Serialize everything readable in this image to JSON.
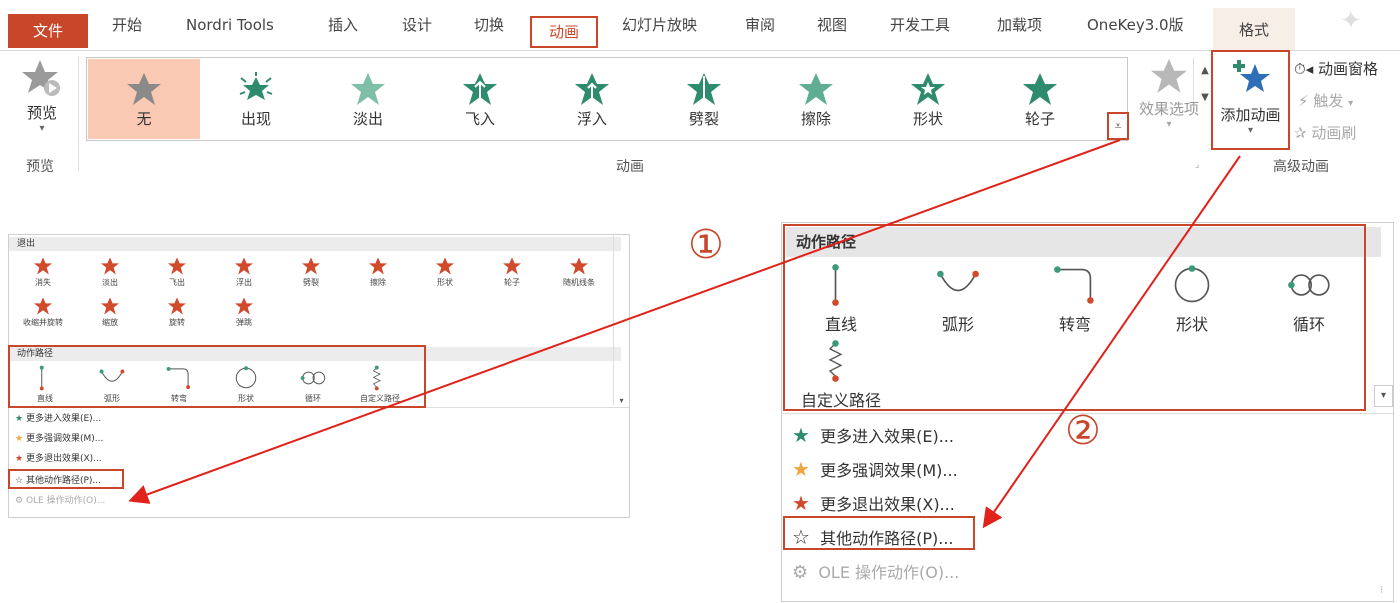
{
  "tabs": {
    "file": "文件",
    "home": "开始",
    "nordri": "Nordri Tools",
    "insert": "插入",
    "design": "设计",
    "transitions": "切换",
    "animations": "动画",
    "slideshow": "幻灯片放映",
    "review": "审阅",
    "view": "视图",
    "developer": "开发工具",
    "addins": "加载项",
    "onekey": "OneKey3.0版",
    "format": "格式"
  },
  "ribbon": {
    "preview_label": "预览",
    "preview_group": "预览",
    "animation_group": "动画",
    "effect_options": "效果选项",
    "add_animation": "添加动画",
    "animation_pane": "动画窗格",
    "trigger": "触发",
    "animation_painter": "动画刷",
    "advanced_group": "高级动画",
    "gallery": [
      "无",
      "出现",
      "淡出",
      "飞入",
      "浮入",
      "劈裂",
      "擦除",
      "形状",
      "轮子"
    ]
  },
  "small_panel": {
    "exit_header": "退出",
    "exit_items": [
      "消失",
      "淡出",
      "飞出",
      "浮出",
      "劈裂",
      "擦除",
      "形状",
      "轮子",
      "随机线条",
      "收缩并旋转",
      "缩放",
      "旋转",
      "弹跳"
    ],
    "path_header": "动作路径",
    "path_items": [
      "直线",
      "弧形",
      "转弯",
      "形状",
      "循环",
      "自定义路径"
    ],
    "more": [
      "更多进入效果(E)...",
      "更多强调效果(M)...",
      "更多退出效果(X)...",
      "其他动作路径(P)...",
      "OLE 操作动作(O)..."
    ]
  },
  "big_panel": {
    "path_header": "动作路径",
    "path_items": [
      "直线",
      "弧形",
      "转弯",
      "形状",
      "循环",
      "自定义路径"
    ],
    "more": [
      "更多进入效果(E)...",
      "更多强调效果(M)...",
      "更多退出效果(X)...",
      "其他动作路径(P)...",
      "OLE 操作动作(O)..."
    ]
  },
  "callouts": [
    "①",
    "②"
  ],
  "colors": {
    "accent": "#c8472b",
    "entrance": "#2e8b6e",
    "emphasis": "#f0a640",
    "exit": "#d24a2c"
  }
}
